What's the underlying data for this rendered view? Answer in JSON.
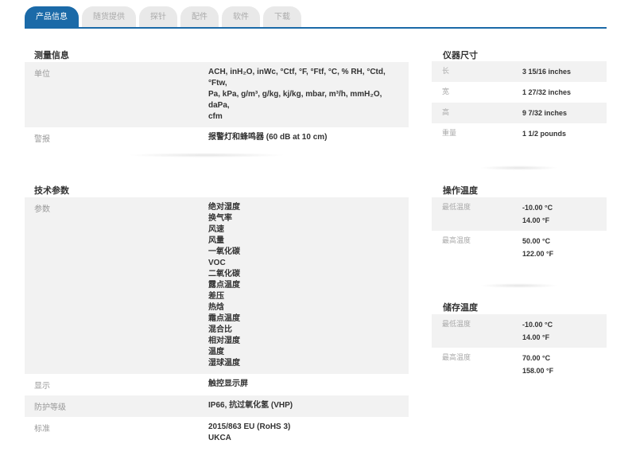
{
  "tabs": [
    {
      "label": "产品信息",
      "active": true
    },
    {
      "label": "随货提供",
      "active": false
    },
    {
      "label": "探针",
      "active": false
    },
    {
      "label": "配件",
      "active": false
    },
    {
      "label": "软件",
      "active": false
    },
    {
      "label": "下载",
      "active": false
    }
  ],
  "measurement": {
    "title": "测量信息",
    "rows": [
      {
        "label": "单位",
        "lines": [
          "ACH, inH₂O, inWc, °Ctf, °F, °Ftf, °C, % RH, °Ctd, °Ftw,",
          "Pa, kPa, g/m³, g/kg, kj/kg, mbar, m³/h, mmH₂O, daPa,",
          "cfm"
        ]
      },
      {
        "label": "警报",
        "lines": [
          "报警灯和蜂鸣器 (60 dB at 10 cm)"
        ]
      }
    ]
  },
  "technical": {
    "title": "技术参数",
    "rows": [
      {
        "label": "参数",
        "lines": [
          "绝对湿度",
          "换气率",
          "风速",
          "风量",
          "一氧化碳",
          "VOC",
          "二氧化碳",
          "露点温度",
          "差压",
          "热焓",
          "霜点温度",
          "混合比",
          "相对湿度",
          "温度",
          "湿球温度"
        ]
      },
      {
        "label": "显示",
        "lines": [
          "触控显示屏"
        ]
      },
      {
        "label": "防护等级",
        "lines": [
          "IP66, 抗过氧化氢 (VHP)"
        ]
      },
      {
        "label": "标准",
        "lines": [
          "2015/863 EU (RoHS 3)",
          "UKCA"
        ]
      }
    ]
  },
  "dimensions": {
    "title": "仪器尺寸",
    "rows": [
      {
        "label": "长",
        "lines": [
          "3 15/16 inches"
        ]
      },
      {
        "label": "宽",
        "lines": [
          "1 27/32 inches"
        ]
      },
      {
        "label": "高",
        "lines": [
          "9 7/32 inches"
        ]
      },
      {
        "label": "重量",
        "lines": [
          "1 1/2 pounds"
        ]
      }
    ]
  },
  "operating_temp": {
    "title": "操作温度",
    "rows": [
      {
        "label": "最低温度",
        "lines": [
          "-10.00 °C",
          "14.00 °F"
        ]
      },
      {
        "label": "最高温度",
        "lines": [
          "50.00 °C",
          "122.00 °F"
        ]
      }
    ]
  },
  "storage_temp": {
    "title": "储存温度",
    "rows": [
      {
        "label": "最低温度",
        "lines": [
          "-10.00 °C",
          "14.00 °F"
        ]
      },
      {
        "label": "最高温度",
        "lines": [
          "70.00 °C",
          "158.00 °F"
        ]
      }
    ]
  },
  "colors": {
    "accent": "#1b6aa8",
    "row_alt": "#f2f2f2",
    "label": "#999999",
    "value": "#333333"
  }
}
